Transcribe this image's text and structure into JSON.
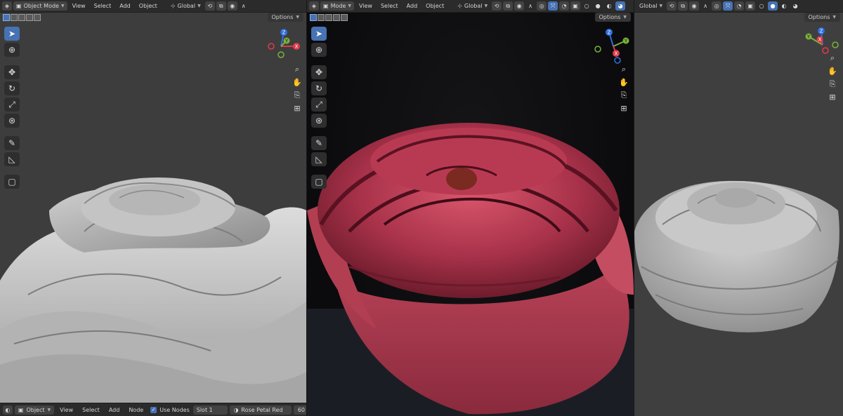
{
  "left_viewport": {
    "mode_label": "Object Mode",
    "menu": [
      "View",
      "Select",
      "Add",
      "Object"
    ],
    "orientation": "Global",
    "options_label": "Options"
  },
  "center_viewport": {
    "mode_label": "Mode",
    "menu": [
      "View",
      "Select",
      "Add",
      "Object"
    ],
    "orientation": "Global",
    "options_label": "Options"
  },
  "right_viewport": {
    "orientation": "Global",
    "options_label": "Options"
  },
  "gizmo_axes": {
    "x": "X",
    "y": "Y",
    "z": "Z"
  },
  "shader_bar": {
    "object_label": "Object",
    "menu": [
      "View",
      "Select",
      "Add",
      "Node"
    ],
    "use_nodes_label": "Use Nodes",
    "slot_label": "Slot 1",
    "material_name": "Rose Petal Red",
    "user_count": "60"
  },
  "colors": {
    "accent": "#4772b3",
    "rose_red": "#b23a4d",
    "clay_gray": "#c9c9c9"
  },
  "icons": [
    "cursor-icon",
    "move-icon",
    "rotate-icon",
    "scale-icon",
    "transform-icon",
    "annotate-icon",
    "measure-icon",
    "add-cube-icon",
    "zoom-icon",
    "hand-icon",
    "camera-icon",
    "grid-icon"
  ]
}
